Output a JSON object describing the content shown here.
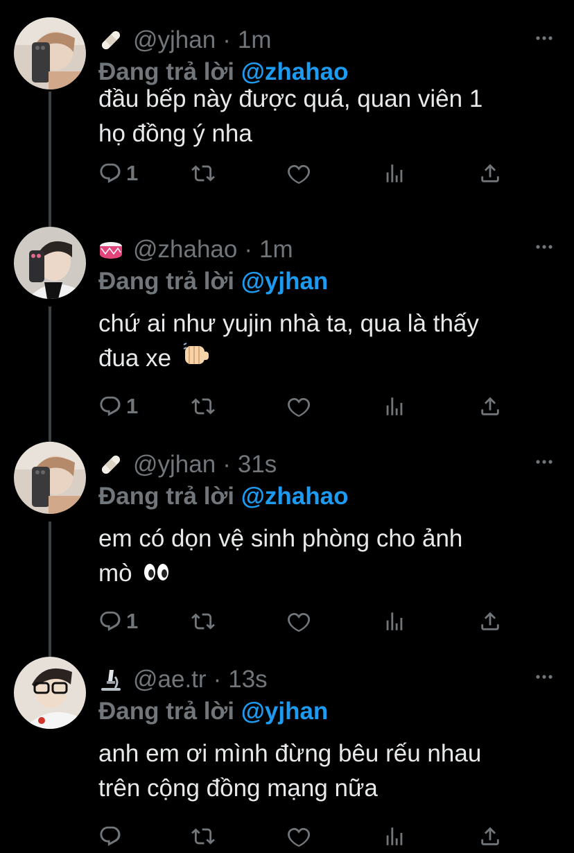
{
  "reply_prefix": "Đang trả lời",
  "separator": "·",
  "colors": {
    "background": "#000000",
    "text": "#e7e9ea",
    "muted": "#71767b",
    "mention": "#1d9bf0",
    "thread_line": "#3e4144"
  },
  "tweets": [
    {
      "handle": "@yjhan",
      "time": "1m",
      "emoji": "bandage-emoji",
      "reply_to": "@zhahao",
      "text_line1": "đầu bếp này được quá, quan viên 1",
      "text_line2": "họ đồng ý nha",
      "reply_count": "1"
    },
    {
      "handle": "@zhahao",
      "time": "1m",
      "emoji": "drum-emoji",
      "reply_to": "@yjhan",
      "text_line1": "chứ ai như yujin nhà ta, qua là thấy",
      "text_line2": "đua xe",
      "text_emoji": "fist-bump-emoji",
      "reply_count": "1"
    },
    {
      "handle": "@yjhan",
      "time": "31s",
      "emoji": "bandage-emoji",
      "reply_to": "@zhahao",
      "text_line1": "em có dọn vệ sinh phòng cho ảnh",
      "text_line2": "mò",
      "text_emoji": "eyes-emoji",
      "reply_count": "1"
    },
    {
      "handle": "@ae.tr",
      "time": "13s",
      "emoji": "microscope-emoji",
      "reply_to": "@yjhan",
      "text_line1": "anh em ơi mình đừng bêu rếu nhau",
      "text_line2": "trên cộng đồng mạng nữa",
      "reply_count": ""
    }
  ]
}
